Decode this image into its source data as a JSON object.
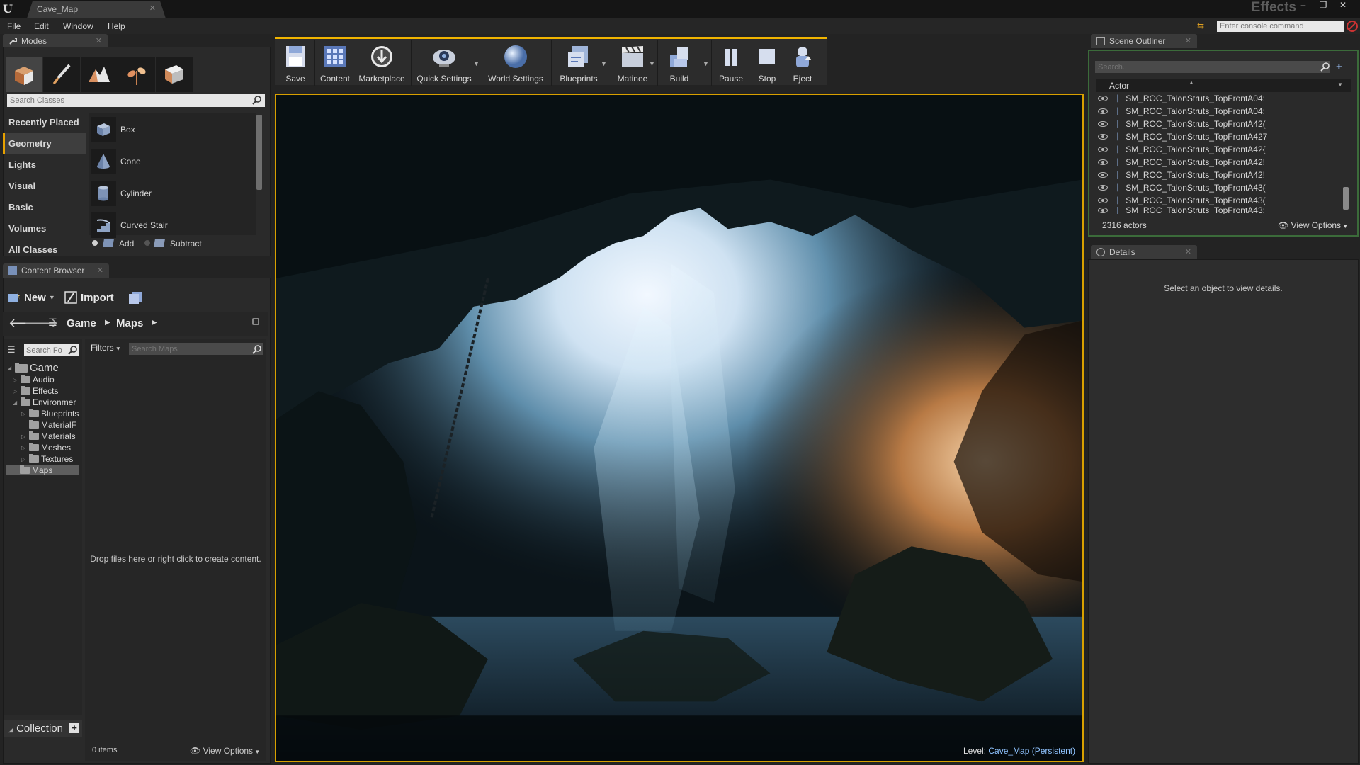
{
  "window": {
    "tab_title": "Cave_Map",
    "project_name": "Effects",
    "controls": [
      "–",
      "❐",
      "✕"
    ]
  },
  "menu": [
    "File",
    "Edit",
    "Window",
    "Help"
  ],
  "console": {
    "placeholder": "Enter console command"
  },
  "modes": {
    "tab": "Modes",
    "search_placeholder": "Search Classes",
    "categories": [
      "Recently Placed",
      "Geometry",
      "Lights",
      "Visual",
      "Basic",
      "Volumes",
      "All Classes"
    ],
    "active_category": "Geometry",
    "items": [
      "Box",
      "Cone",
      "Cylinder",
      "Curved Stair"
    ],
    "add_label": "Add",
    "subtract_label": "Subtract"
  },
  "content_browser": {
    "tab": "Content Browser",
    "new_label": "New",
    "import_label": "Import",
    "breadcrumb": [
      "Game",
      "Maps"
    ],
    "folder_search_placeholder": "Search Fo",
    "filters_label": "Filters",
    "search_placeholder": "Search Maps",
    "tree": {
      "root": "Game",
      "items": [
        "Audio",
        "Effects",
        "Environmer",
        "Blueprints",
        "MaterialF",
        "Materials",
        "Meshes",
        "Textures",
        "Maps"
      ]
    },
    "empty_hint": "Drop files here or right click to create content.",
    "item_count": "0 items",
    "view_options": "View Options",
    "collections_label": "Collection"
  },
  "toolbar": {
    "buttons": [
      "Save",
      "Content",
      "Marketplace",
      "Quick Settings",
      "World Settings",
      "Blueprints",
      "Matinee",
      "Build",
      "Pause",
      "Stop",
      "Eject"
    ]
  },
  "viewport": {
    "level_prefix": "Level:",
    "level_name": "Cave_Map (Persistent)"
  },
  "outliner": {
    "tab": "Scene Outliner",
    "search_placeholder": "Search...",
    "column": "Actor",
    "rows": [
      "SM_ROC_TalonStruts_TopFrontA04:",
      "SM_ROC_TalonStruts_TopFrontA04:",
      "SM_ROC_TalonStruts_TopFrontA42(",
      "SM_ROC_TalonStruts_TopFrontA427",
      "SM_ROC_TalonStruts_TopFrontA42{",
      "SM_ROC_TalonStruts_TopFrontA42!",
      "SM_ROC_TalonStruts_TopFrontA42!",
      "SM_ROC_TalonStruts_TopFrontA43(",
      "SM_ROC_TalonStruts_TopFrontA43(",
      "SM_ROC_TalonStruts_TopFrontA43:"
    ],
    "actor_count": "2316 actors",
    "view_options": "View Options"
  },
  "details": {
    "tab": "Details",
    "empty_message": "Select an object to view details."
  },
  "colors": {
    "accent": "#e6a100",
    "viewport_border": "#d8a000",
    "level_link": "#8fc3ff"
  }
}
